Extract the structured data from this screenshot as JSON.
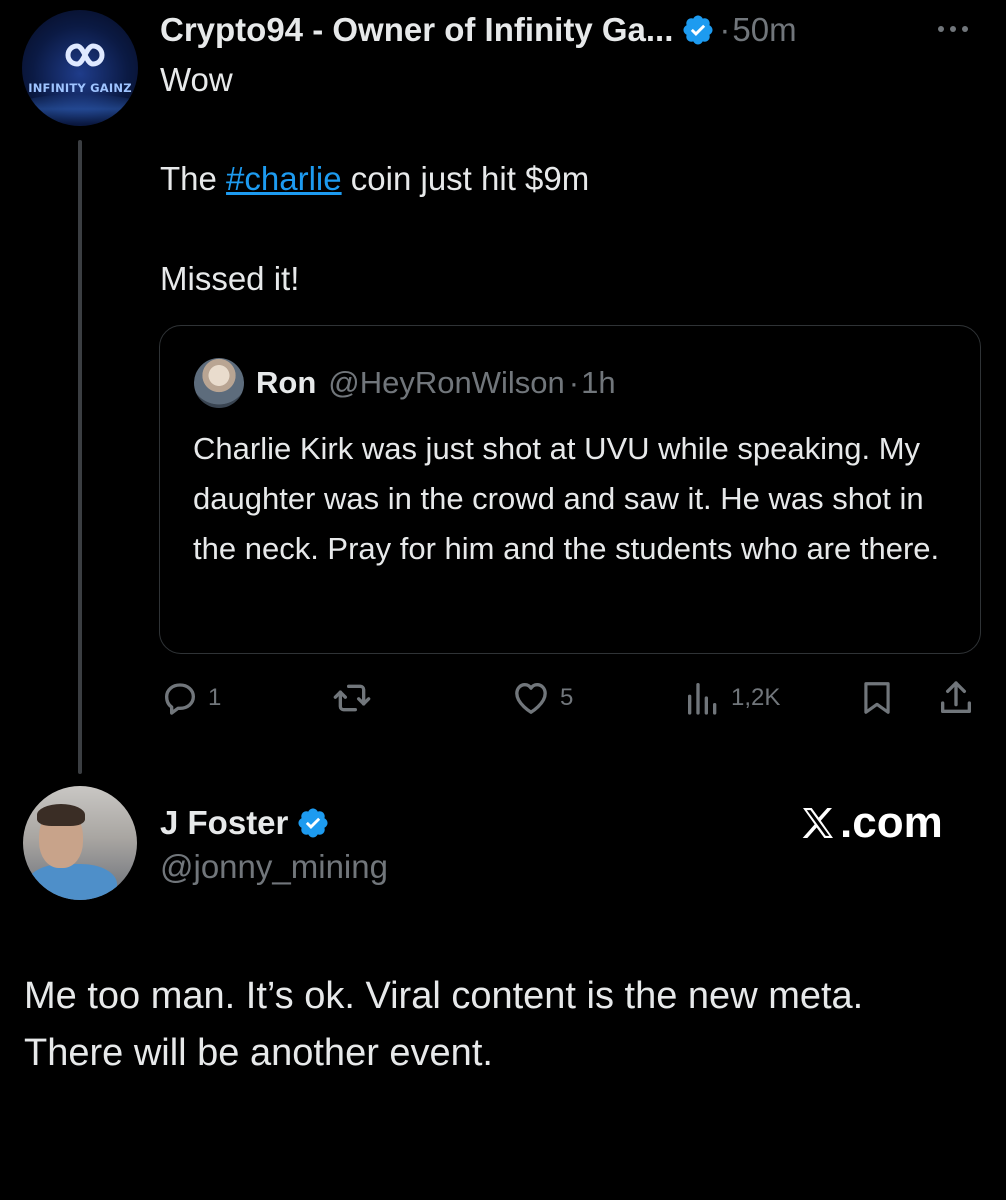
{
  "tweet": {
    "author": {
      "display_name": "Crypto94 - Owner of Infinity Ga...",
      "verified": true,
      "avatar_logo_text": "INFINITY GAINZ"
    },
    "separator": "·",
    "timestamp": "50m",
    "lines": {
      "first": "Wow",
      "coin_prefix": "The ",
      "coin_hashtag": "#charlie",
      "coin_suffix": " coin just hit $9m",
      "last": "Missed it!"
    },
    "quote": {
      "display_name": "Ron",
      "handle": "@HeyRonWilson",
      "separator": "·",
      "timestamp": "1h",
      "text": "Charlie Kirk was just shot at UVU while speaking. My daughter was in the crowd and saw it. He was shot in the neck. Pray for him and the students who are there."
    },
    "actions": {
      "replies": "1",
      "likes": "5",
      "views": "1,2K"
    }
  },
  "reply": {
    "display_name": "J Foster",
    "verified": true,
    "handle": "@jonny_mining",
    "brand": ".com",
    "lines": [
      "Me too man. It’s ok. Viral content is the new meta.",
      "There will be another event."
    ]
  },
  "colors": {
    "background": "#000000",
    "text": "#e7e9ea",
    "muted": "#71767b",
    "link": "#1d9bf0",
    "verified": "#1d9bf0",
    "border": "#2f3336"
  },
  "icons": [
    "verified-badge-icon",
    "more-icon",
    "reply-icon",
    "retweet-icon",
    "like-icon",
    "views-icon",
    "bookmark-icon",
    "share-icon",
    "x-logo-icon"
  ]
}
